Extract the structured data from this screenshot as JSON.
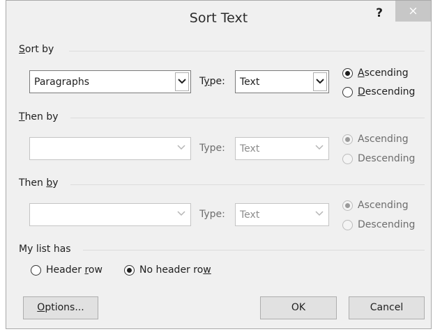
{
  "window": {
    "title": "Sort Text",
    "help_label": "?",
    "close_label": "×"
  },
  "sort_by": {
    "label_u": "S",
    "label_rest": "ort by",
    "field_value": "Paragraphs",
    "type_label_pre": "T",
    "type_label_u": "y",
    "type_label_post": "pe:",
    "type_value": "Text",
    "ascending_u": "A",
    "ascending_rest": "scending",
    "descending_u": "D",
    "descending_rest": "escending",
    "selected": "Ascending"
  },
  "then_by_1": {
    "label_u": "T",
    "label_rest": "hen by",
    "field_value": "",
    "type_label": "Type:",
    "type_value": "Text",
    "ascending": "Ascending",
    "descending": "Descending",
    "selected": "Ascending",
    "enabled": false
  },
  "then_by_2": {
    "label_pre": "Then ",
    "label_u": "b",
    "label_post": "y",
    "field_value": "",
    "type_label": "Type:",
    "type_value": "Text",
    "ascending": "Ascending",
    "descending": "Descending",
    "selected": "Ascending",
    "enabled": false
  },
  "my_list_has": {
    "label": "My list has",
    "header_row_pre": "Header ",
    "header_row_u": "r",
    "header_row_post": "ow",
    "no_header_row_pre": "No header ro",
    "no_header_row_u": "w",
    "selected": "No header row"
  },
  "buttons": {
    "options_u": "O",
    "options_rest": "ptions...",
    "ok": "OK",
    "cancel": "Cancel"
  },
  "colors": {
    "dialog_bg": "#f0f0f0",
    "close_button_bg": "#c7c7c7",
    "disabled_text": "#6d6d6d"
  }
}
